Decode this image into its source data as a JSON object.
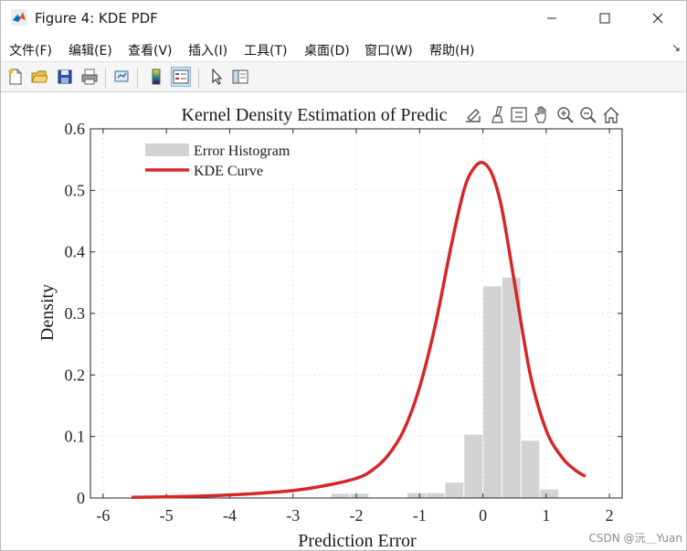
{
  "window": {
    "title": "Figure 4: KDE PDF",
    "minimize_glyph": "—",
    "maximize_glyph": "☐",
    "close_glyph": "✕"
  },
  "menu": {
    "items": [
      "文件(F)",
      "编辑(E)",
      "查看(V)",
      "插入(I)",
      "工具(T)",
      "桌面(D)",
      "窗口(W)",
      "帮助(H)"
    ],
    "dock_glyph": "↘"
  },
  "toolbar": {
    "buttons": [
      "new-figure-icon",
      "open-file-icon",
      "save-icon",
      "print-icon",
      "link-plot-icon",
      "insert-colorbar-icon",
      "insert-legend-icon",
      "edit-plot-pointer-icon",
      "property-inspector-icon"
    ],
    "active": [
      "insert-legend-icon"
    ]
  },
  "axes_toolbar": {
    "buttons": [
      "export-icon",
      "brush-icon",
      "data-tips-icon",
      "pan-hand-icon",
      "zoom-in-icon",
      "zoom-out-icon",
      "home-icon"
    ]
  },
  "colors": {
    "histogram": "#d3d3d3",
    "kde": "#d62728",
    "grid": "#e6e6e6"
  },
  "chart_data": {
    "type": "bar",
    "title": "Kernel Density Estimation of Predic",
    "xlabel": "Prediction Error",
    "ylabel": "Density",
    "xlim": [
      -6.2,
      2.2
    ],
    "ylim": [
      0,
      0.6
    ],
    "xticks": [
      -6,
      -5,
      -4,
      -3,
      -2,
      -1,
      0,
      1,
      2
    ],
    "yticks": [
      0,
      0.1,
      0.2,
      0.3,
      0.4,
      0.5,
      0.6
    ],
    "grid": true,
    "legend_position": "top-left",
    "series": [
      {
        "name": "Error Histogram",
        "kind": "histogram",
        "bin_edges": [
          -2.4,
          -2.1,
          -1.8,
          -1.5,
          -1.2,
          -0.9,
          -0.6,
          -0.3,
          0.0,
          0.3,
          0.6,
          0.9
        ],
        "values": [
          0.007,
          0.007,
          0.0,
          0.0,
          0.008,
          0.008,
          0.025,
          0.103,
          0.344,
          0.358,
          0.093,
          0.014
        ]
      },
      {
        "name": "KDE Curve",
        "kind": "line",
        "x": [
          -5.55,
          -5.0,
          -4.5,
          -4.0,
          -3.5,
          -3.0,
          -2.5,
          -2.0,
          -1.75,
          -1.5,
          -1.25,
          -1.0,
          -0.75,
          -0.5,
          -0.3,
          -0.15,
          0.0,
          0.15,
          0.3,
          0.5,
          0.75,
          1.0,
          1.25,
          1.45,
          1.62
        ],
        "y": [
          0.001,
          0.002,
          0.003,
          0.005,
          0.008,
          0.012,
          0.02,
          0.032,
          0.045,
          0.069,
          0.11,
          0.18,
          0.282,
          0.41,
          0.5,
          0.535,
          0.545,
          0.525,
          0.47,
          0.35,
          0.2,
          0.11,
          0.066,
          0.046,
          0.035
        ]
      }
    ]
  },
  "watermark": "CSDN @沅＿Yuan"
}
